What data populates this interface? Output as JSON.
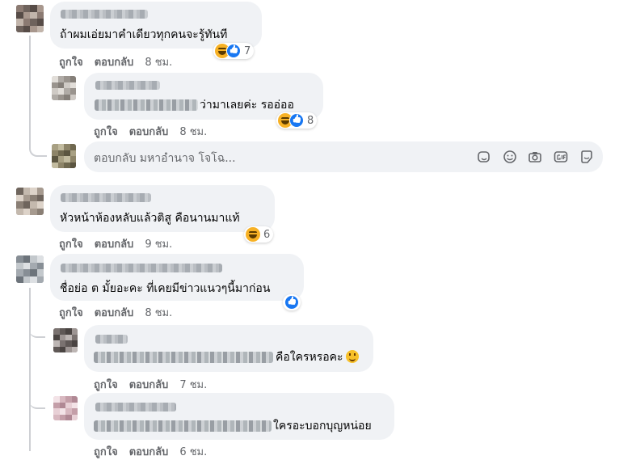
{
  "labels": {
    "like": "ถูกใจ",
    "reply": "ตอบกลับ"
  },
  "comments": [
    {
      "text": "ถ้าผมเอ่ยมาคำเดียวทุกคนจะรู้ทันที",
      "time": "8 ชม.",
      "reactions": {
        "types": [
          "haha-icon",
          "like-icon"
        ],
        "count": "7"
      }
    },
    {
      "text": "ว่ามาเลยค่ะ รออ่ออ",
      "time": "8 ชม.",
      "reactions": {
        "types": [
          "haha-icon",
          "like-icon"
        ],
        "count": "8"
      }
    },
    {
      "text": "หัวหน้าห้องหลับแล้วติสู คือนานมาแท้",
      "time": "9 ชม.",
      "reactions": {
        "types": [
          "haha-icon"
        ],
        "count": "6"
      }
    },
    {
      "text": "ชื่อย่อ ต มั้ยอะคะ ที่เคยมีข่าวแนวๆนี้มาก่อน",
      "time": "8 ชม.",
      "reactions": {
        "types": [
          "like-icon"
        ],
        "count": ""
      }
    },
    {
      "text": "คือใครหรอคะ",
      "time": "7 ชม.",
      "emoji": "grinning-face-icon"
    },
    {
      "text": "ใครอะบอกบุญหน่อย",
      "time": "6 ชม."
    }
  ],
  "reply_box": {
    "placeholder": "ตอบกลับ มหาอำนาจ โจโฉ...",
    "tools": [
      "sticker-icon",
      "emoji-icon",
      "camera-icon",
      "gif-icon",
      "comment-sticker-icon"
    ]
  },
  "colors": {
    "bubble": "#f0f2f5",
    "meta": "#65676b",
    "like_blue": "#1877f2",
    "haha_yellow": "#f7b125"
  }
}
